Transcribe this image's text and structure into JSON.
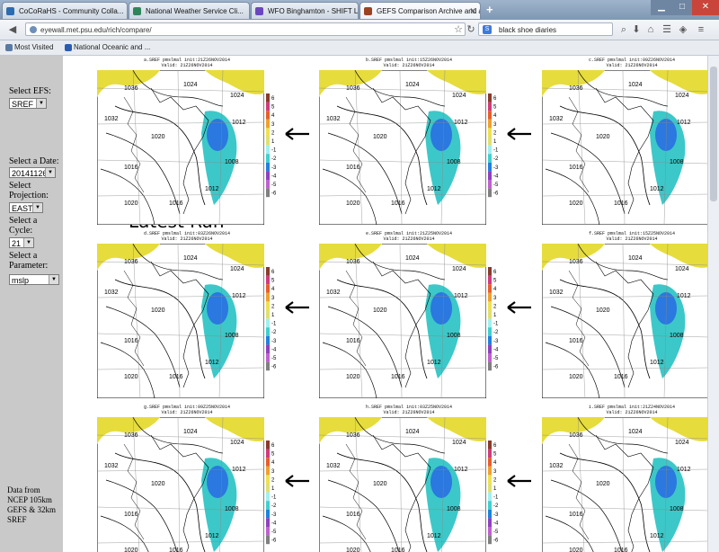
{
  "browser": {
    "tabs": [
      {
        "label": "CoCoRaHS - Community Colla...",
        "color": "#2b6cb0"
      },
      {
        "label": "National Weather Service Cli...",
        "color": "#2f855a"
      },
      {
        "label": "WFO Binghamton - SHIFT LOG",
        "color": "#6b46c1"
      },
      {
        "label": "GEFS Comparison Archive and acti...",
        "color": "#9c4221"
      }
    ],
    "new_tab": "+",
    "url": "eyewall.met.psu.edu/rich/compare/",
    "search_text": "black shoe diaries",
    "bookmarks": [
      "Most Visited",
      "National Oceanic and ..."
    ]
  },
  "sidebar": {
    "efs_label": "Select EFS:",
    "efs_value": "SREF",
    "date_label": "Select a Date:",
    "date_value": "20141126",
    "projection_label": "Select Projection:",
    "projection_value": "EAST",
    "cycle_label": "Select a Cycle:",
    "cycle_value": "21",
    "parameter_label": "Select a Parameter:",
    "parameter_value": "mslp",
    "footnote": "Data from NCEP 105km GEFS & 32km SREF"
  },
  "latest_label": "Latest Run",
  "panels": [
    {
      "title": "a.SREF  pmslmal init:21Z26NOV2014",
      "valid": "Valid: 21Z26NOV2014"
    },
    {
      "title": "b.SREF  pmslmal init:15Z26NOV2014",
      "valid": "Valid: 21Z26NOV2014"
    },
    {
      "title": "c.SREF  pmslmal init:09Z26NOV2014",
      "valid": "Valid: 21Z26NOV2014"
    },
    {
      "title": "d.SREF  pmslmal init:03Z26NOV2014",
      "valid": "Valid: 21Z26NOV2014"
    },
    {
      "title": "e.SREF  pmslmal init:21Z25NOV2014",
      "valid": "Valid: 21Z26NOV2014"
    },
    {
      "title": "f.SREF  pmslmal init:15Z25NOV2014",
      "valid": "Valid: 21Z26NOV2014"
    },
    {
      "title": "g.SREF  pmslmal init:09Z25NOV2014",
      "valid": "Valid: 21Z26NOV2014"
    },
    {
      "title": "h.SREF  pmslmal init:03Z25NOV2014",
      "valid": "Valid: 21Z26NOV2014"
    },
    {
      "title": "i.SREF  pmslmal init:21Z24NOV2014",
      "valid": "Valid: 21Z26NOV2014"
    }
  ],
  "colorbar_labels": [
    "6",
    "5",
    "4",
    "3",
    "2",
    "1",
    "-1",
    "-2",
    "-3",
    "-4",
    "-5",
    "-6"
  ],
  "isobar_labels": [
    "1036",
    "1032",
    "1028",
    "1024",
    "1020",
    "1016",
    "1012",
    "1008",
    "1004"
  ],
  "colors": {
    "land_yellow": "#e6dc3c",
    "low_cyan": "#3cc8c8",
    "low_blue": "#2a78e0"
  }
}
